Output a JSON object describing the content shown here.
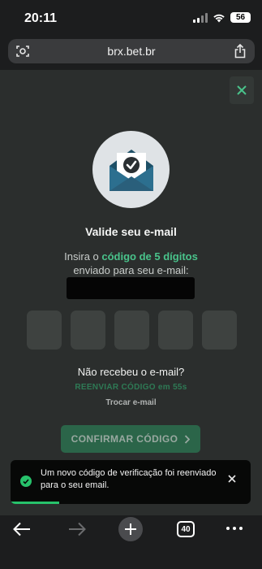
{
  "status_bar": {
    "time": "20:11",
    "battery": "56"
  },
  "browser": {
    "url": "brx.bet.br",
    "tabs_count": "40"
  },
  "modal": {
    "title": "Valide seu e-mail",
    "instruction_prefix": "Insira o ",
    "instruction_highlight": "código de 5 dígitos",
    "instruction_line2": "enviado para seu e-mail:",
    "code_length": 5,
    "not_received": "Não recebeu o e-mail?",
    "resend": "REENVIAR CÓDIGO em 55s",
    "change_email": "Trocar e-mail",
    "confirm": "CONFIRMAR CÓDIGO"
  },
  "toast": {
    "message": "Um novo código de verificação foi reenviado para o seu email."
  },
  "colors": {
    "accent": "#49c38b",
    "button": "#2b6549",
    "toast_success": "#27c26b"
  }
}
